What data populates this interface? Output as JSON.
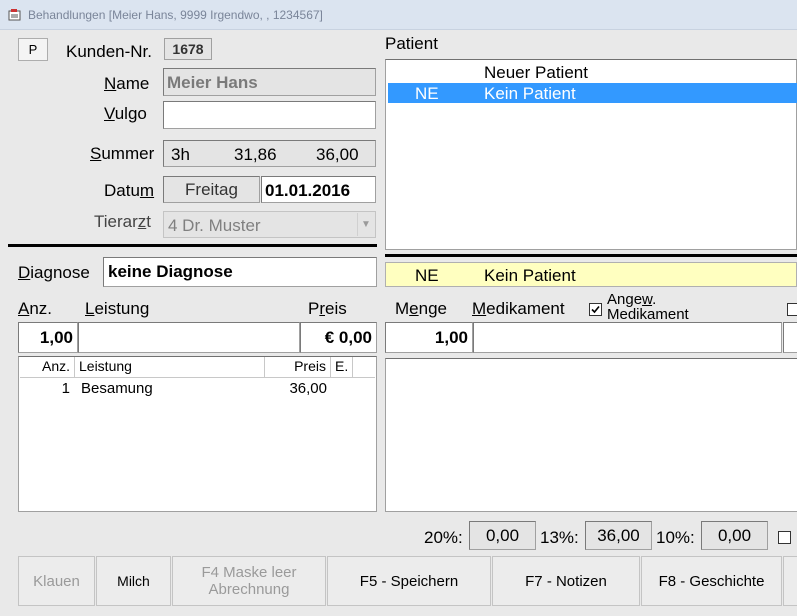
{
  "window": {
    "title": "Behandlungen [Meier Hans, 9999 Irgendwo, , 1234567]"
  },
  "customer": {
    "p_button": "P",
    "kunden_nr_label": "Kunden-Nr.",
    "kunden_nr_value": "1678",
    "name_label_pre": "",
    "name_label_u": "N",
    "name_label_post": "ame",
    "name_value": "Meier Hans",
    "vulgo_label_u": "V",
    "vulgo_label_post": "ulgo",
    "vulgo_value": "",
    "summer_label_u": "S",
    "summer_label_post": "ummer",
    "summer_hours": "3h",
    "summer_value1": "31,86",
    "summer_value2": "36,00",
    "datum_label_pre": "Datu",
    "datum_label_u": "m",
    "weekday": "Freitag",
    "date": "01.01.2016",
    "tierarzt_label_pre": "Tierar",
    "tierarzt_label_u": "z",
    "tierarzt_label_post": "t",
    "tierarzt_value": "4  Dr. Muster"
  },
  "patient": {
    "label": "Patient",
    "rows": [
      {
        "code": "",
        "name": "Neuer Patient",
        "selected": false
      },
      {
        "code": "NE",
        "name": "Kein Patient",
        "selected": true
      }
    ],
    "current_code": "NE",
    "current_name": "Kein Patient"
  },
  "diagnose": {
    "label_u": "D",
    "label_post": "iagnose",
    "value": "keine Diagnose"
  },
  "leistung": {
    "anz_label_u": "A",
    "anz_label_post": "nz.",
    "leistung_label_u": "L",
    "leistung_label_post": "eistung",
    "preis_label_pre": "P",
    "preis_label_u": "r",
    "preis_label_post": "eis",
    "anz_input": "1,00",
    "leistung_input": "",
    "preis_input": "€ 0,00",
    "columns": [
      "Anz.",
      "Leistung",
      "Preis",
      "E."
    ],
    "rows": [
      {
        "anz": "1",
        "leistung": "Besamung",
        "preis": "36,00",
        "e": ""
      }
    ]
  },
  "medikament": {
    "menge_label_pre": "M",
    "menge_label_u": "e",
    "menge_label_post": "nge",
    "medikament_label_u": "M",
    "medikament_label_post": "edikament",
    "angew_label_pre": "Ange",
    "angew_label_u": "w",
    "angew_label_post": ".",
    "angew_label_line2": "Medikament",
    "menge_input": "1,00",
    "medikament_input": ""
  },
  "tax": {
    "rate1_label": "20%:",
    "rate1_value": "0,00",
    "rate2_label": "13%:",
    "rate2_value": "36,00",
    "rate3_label": "10%:",
    "rate3_value": "0,00"
  },
  "buttons": {
    "klauen": "Klauen",
    "milch": "Milch",
    "f4_line1": "F4 Maske leer",
    "f4_line2": "Abrechnung",
    "f5": "F5 - Speichern",
    "f7": "F7 - Notizen",
    "f8": "F8 - Geschichte"
  },
  "colors": {
    "selection": "#3399ff",
    "current_patient_bg": "#ffffc0"
  }
}
